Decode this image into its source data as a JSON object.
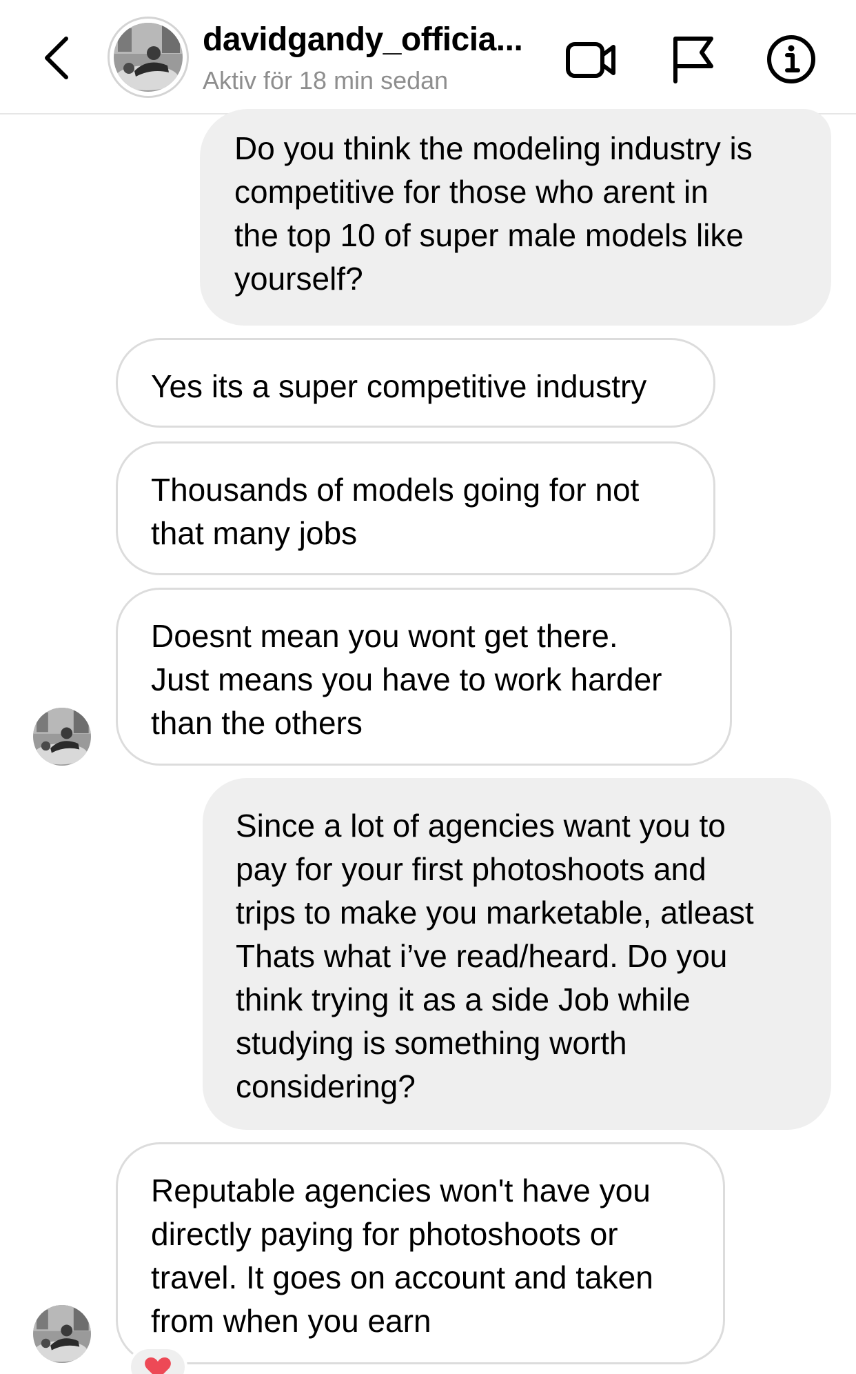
{
  "header": {
    "username": "davidgandy_officia...",
    "status": "Aktiv för 18 min sedan"
  },
  "icons": {
    "back": "chevron-left-icon",
    "video": "video-camera-icon",
    "report": "flag-icon",
    "info": "info-icon"
  },
  "messages": [
    {
      "direction": "sent",
      "text": "Do you think the modeling industry is\ncompetitive for those who arent in\nthe top 10 of super male models like\nyourself?"
    },
    {
      "direction": "received",
      "text": "Yes its a super competitive industry"
    },
    {
      "direction": "received",
      "text": "Thousands of models going for not\nthat many jobs"
    },
    {
      "direction": "received",
      "text": "Doesnt mean you wont get there.\nJust means you have to work harder\nthan the others"
    },
    {
      "direction": "sent",
      "text": "Since a lot of agencies want you to\npay for your first photoshoots and\ntrips to make you marketable, atleast\nThats what i’ve read/heard. Do you\nthink trying it as a side Job while\nstudying is something worth\nconsidering?"
    },
    {
      "direction": "received",
      "text": "Reputable agencies won't have you\ndirectly paying for photoshoots or\ntravel. It goes on account and taken\nfrom when you earn"
    }
  ],
  "reaction": {
    "icon": "heart-icon",
    "color": "#ed4956"
  },
  "colors": {
    "sent_bubble": "#efefef",
    "received_border": "#dcdcdc",
    "secondary_text": "#8e8e8e"
  }
}
